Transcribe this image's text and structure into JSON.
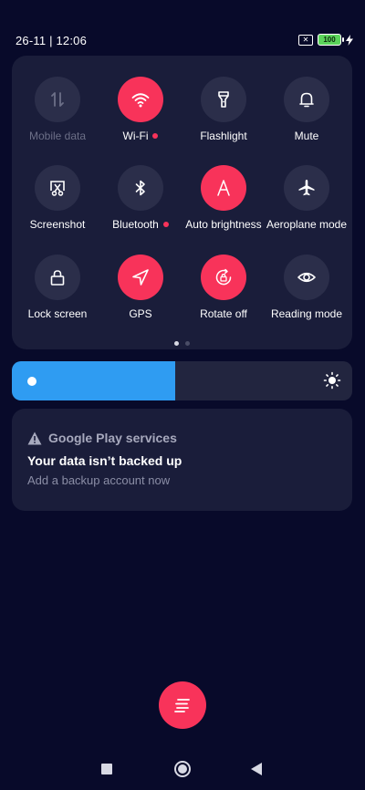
{
  "status_bar": {
    "datetime": "26-11 | 12:06",
    "battery_level": "100",
    "sim_icon": "no-sim-icon",
    "charging_icon": "lightning-icon"
  },
  "quick_settings": {
    "tiles": [
      {
        "label": "Mobile data",
        "icon": "mobile-data-icon",
        "active": false,
        "disabled": true
      },
      {
        "label": "Wi-Fi",
        "icon": "wifi-icon",
        "active": true,
        "dot": true
      },
      {
        "label": "Flashlight",
        "icon": "flashlight-icon",
        "active": false
      },
      {
        "label": "Mute",
        "icon": "bell-icon",
        "active": false
      },
      {
        "label": "Screenshot",
        "icon": "screenshot-icon",
        "active": false
      },
      {
        "label": "Bluetooth",
        "icon": "bluetooth-icon",
        "active": false,
        "dot": true
      },
      {
        "label": "Auto brightness",
        "icon": "auto-brightness-icon",
        "active": true
      },
      {
        "label": "Aeroplane mode",
        "icon": "airplane-icon",
        "active": false
      },
      {
        "label": "Lock screen",
        "icon": "lock-icon",
        "active": false
      },
      {
        "label": "GPS",
        "icon": "location-arrow-icon",
        "active": true
      },
      {
        "label": "Rotate off",
        "icon": "rotation-lock-icon",
        "active": true
      },
      {
        "label": "Reading mode",
        "icon": "eye-icon",
        "active": false
      }
    ],
    "pages": {
      "count": 2,
      "current": 1
    }
  },
  "brightness": {
    "level_fraction": 0.48,
    "icon": "sun-icon"
  },
  "notification": {
    "app_name": "Google Play services",
    "app_icon": "warning-icon",
    "title": "Your data isn’t backed up",
    "body": "Add a backup account now"
  },
  "clear_button": {
    "icon": "clear-all-icon"
  },
  "navbar": {
    "recents_icon": "recents-square-icon",
    "home_icon": "home-circle-icon",
    "back_icon": "back-triangle-icon"
  },
  "colors": {
    "background": "#080a2a",
    "panel": "#1a1d3a",
    "accent": "#f8335a",
    "brightness_fill": "#2f9cf2"
  }
}
